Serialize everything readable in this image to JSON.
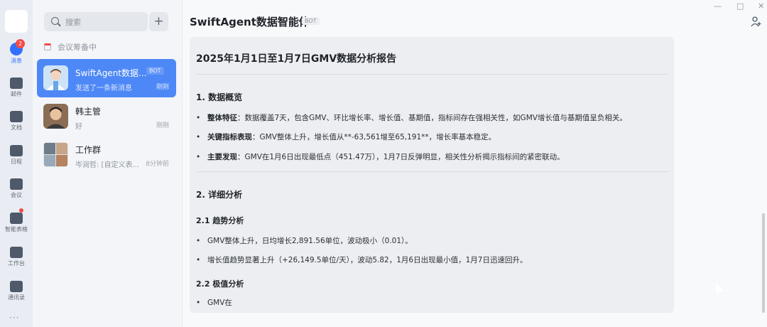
{
  "rail": {
    "badge_count": "2",
    "items": [
      {
        "label": "消息",
        "icon": "chat-bubble-icon"
      },
      {
        "label": "邮件",
        "icon": "mail-icon"
      },
      {
        "label": "文档",
        "icon": "document-icon"
      },
      {
        "label": "日程",
        "icon": "calendar-icon"
      },
      {
        "label": "会议",
        "icon": "video-meeting-icon"
      },
      {
        "label": "智能表格",
        "icon": "smart-table-icon"
      },
      {
        "label": "工作台",
        "icon": "workbench-grid-icon"
      },
      {
        "label": "通讯录",
        "icon": "contacts-org-icon"
      }
    ],
    "more": "···"
  },
  "chatlist": {
    "search_placeholder": "搜索",
    "add_label": "+",
    "meeting_status": "会议筹备中",
    "conversations": [
      {
        "name": "SwiftAgent数据...",
        "tag": "BOT",
        "last_message": "发送了一条新消息",
        "time": "刚刚"
      },
      {
        "name": "韩主管",
        "last_message": "好",
        "time": "刚刚"
      },
      {
        "name": "工作群",
        "last_message": "岑润哲: [自定义表...",
        "time": "8分钟前"
      }
    ]
  },
  "header": {
    "title": "SwiftAgent数据智能体",
    "tag": "BOT",
    "window_controls": [
      "—",
      "□",
      "✕"
    ]
  },
  "report": {
    "title": "2025年1月1日至1月7日GMV数据分析报告",
    "section1_title": "1. 数据概览",
    "section1_bullets": [
      {
        "k": "整体特征",
        "t": "：数据覆盖7天，包含GMV、环比增长率、增长值、基期值，指标间存在强相关性，如GMV增长值与基期值呈负相关。"
      },
      {
        "k": "关键指标表现",
        "t": "：GMV整体上升，增长值从**-63,561增至65,191**，增长率基本稳定。"
      },
      {
        "k": "主要发现",
        "t": "：GMV在1月6日出现最低点（451.47万），1月7日反弹明显，相关性分析揭示指标间的紧密联动。"
      }
    ],
    "section2_title": "2. 详细分析",
    "sub1_title": "2.1 趋势分析",
    "sub1_bullets": [
      "GMV整体上升，日均增长2,891.56单位，波动极小（0.01）。",
      "增长值趋势显著上升（+26,149.5单位/天），波动5.82，1月6日出现最小值，1月7日迅速回升。"
    ],
    "sub2_title": "2.2 极值分析",
    "sub2_bullets": [
      "GMV在"
    ]
  }
}
